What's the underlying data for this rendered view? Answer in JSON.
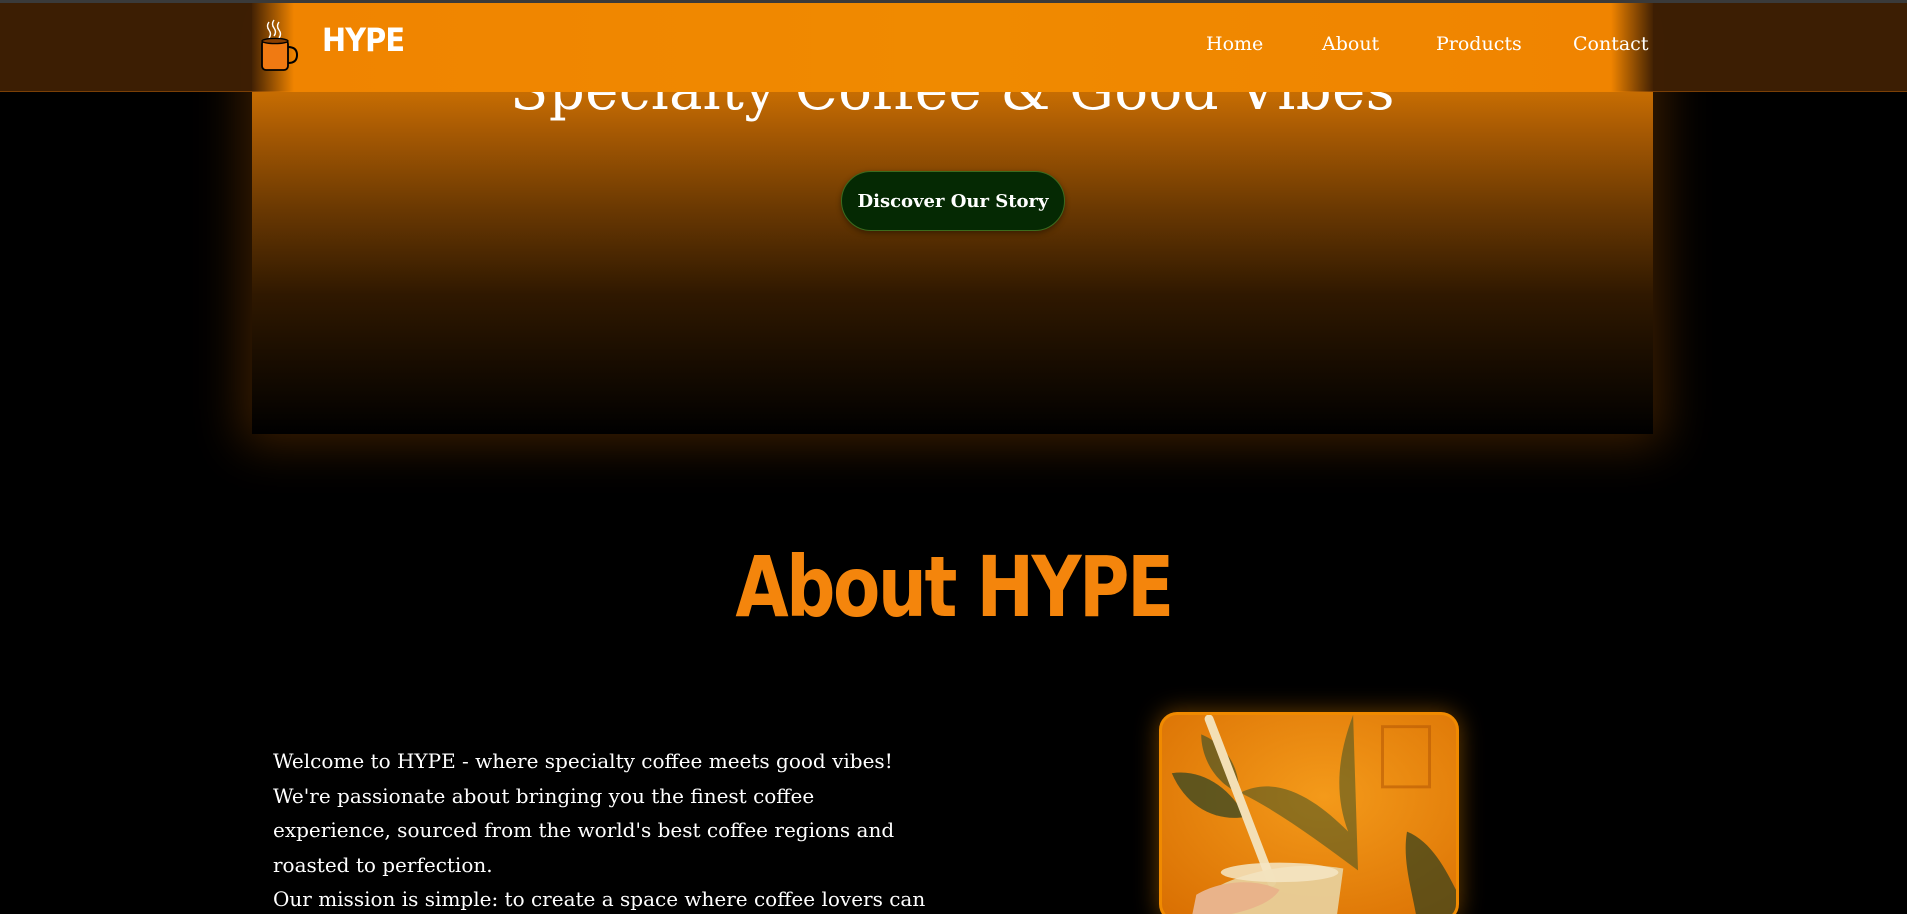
{
  "brand": {
    "name": "HYPE",
    "logo_icon": "coffee-mug-icon"
  },
  "nav": {
    "items": [
      {
        "label": "Home"
      },
      {
        "label": "About"
      },
      {
        "label": "Products"
      },
      {
        "label": "Contact"
      }
    ]
  },
  "hero": {
    "title": "Specialty Coffee & Good Vibes",
    "cta_label": "Discover Our Story"
  },
  "about": {
    "heading": "About HYPE",
    "paragraphs": [
      "Welcome to HYPE - where specialty coffee meets good vibes!",
      "We're passionate about bringing you the finest coffee experience, sourced from the world's best coffee regions and roasted to perfection.",
      "Our mission is simple: to create a space where coffee lovers can"
    ],
    "photo_icon": "iced-drink-photo"
  },
  "colors": {
    "accent": "#f08a00",
    "heading_orange": "#f4850c",
    "cta_green": "#052903",
    "nav_brown": "#3e1f03"
  }
}
